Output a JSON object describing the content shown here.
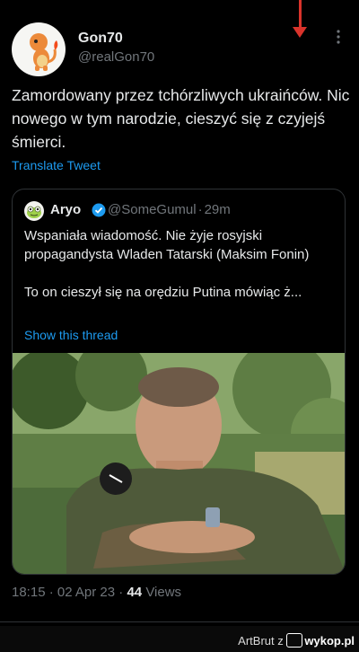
{
  "tweet": {
    "author": {
      "display_name": "Gon70",
      "handle": "@realGon70"
    },
    "text": "Zamordowany przez tchórzliwych ukraińców. Nic nowego w tym narodzie, cieszyć się z czyjejś śmierci.",
    "translate_label": "Translate Tweet",
    "time": "18:15",
    "date": "02 Apr 23",
    "views_count": "44",
    "views_label": "Views"
  },
  "quote": {
    "author": {
      "display_name": "Aryo",
      "handle": "@SomeGumul",
      "age": "29m"
    },
    "text": "Wspaniała wiadomość. Nie żyje rosyjski propagandysta Wladen Tatarski (Maksim Fonin)\n\nTo on cieszył się na orędziu Putina mówiąc ż...",
    "show_thread_label": "Show this thread"
  },
  "watermark": {
    "user": "ArtBrut",
    "connector": "z",
    "site": "wykop.pl"
  },
  "icons": {
    "more": "more-options-icon",
    "verified": "verified-badge-icon"
  },
  "colors": {
    "accent": "#1d9bf0",
    "background": "#000000",
    "annotation": "#d9332b",
    "muted": "#71767b"
  }
}
